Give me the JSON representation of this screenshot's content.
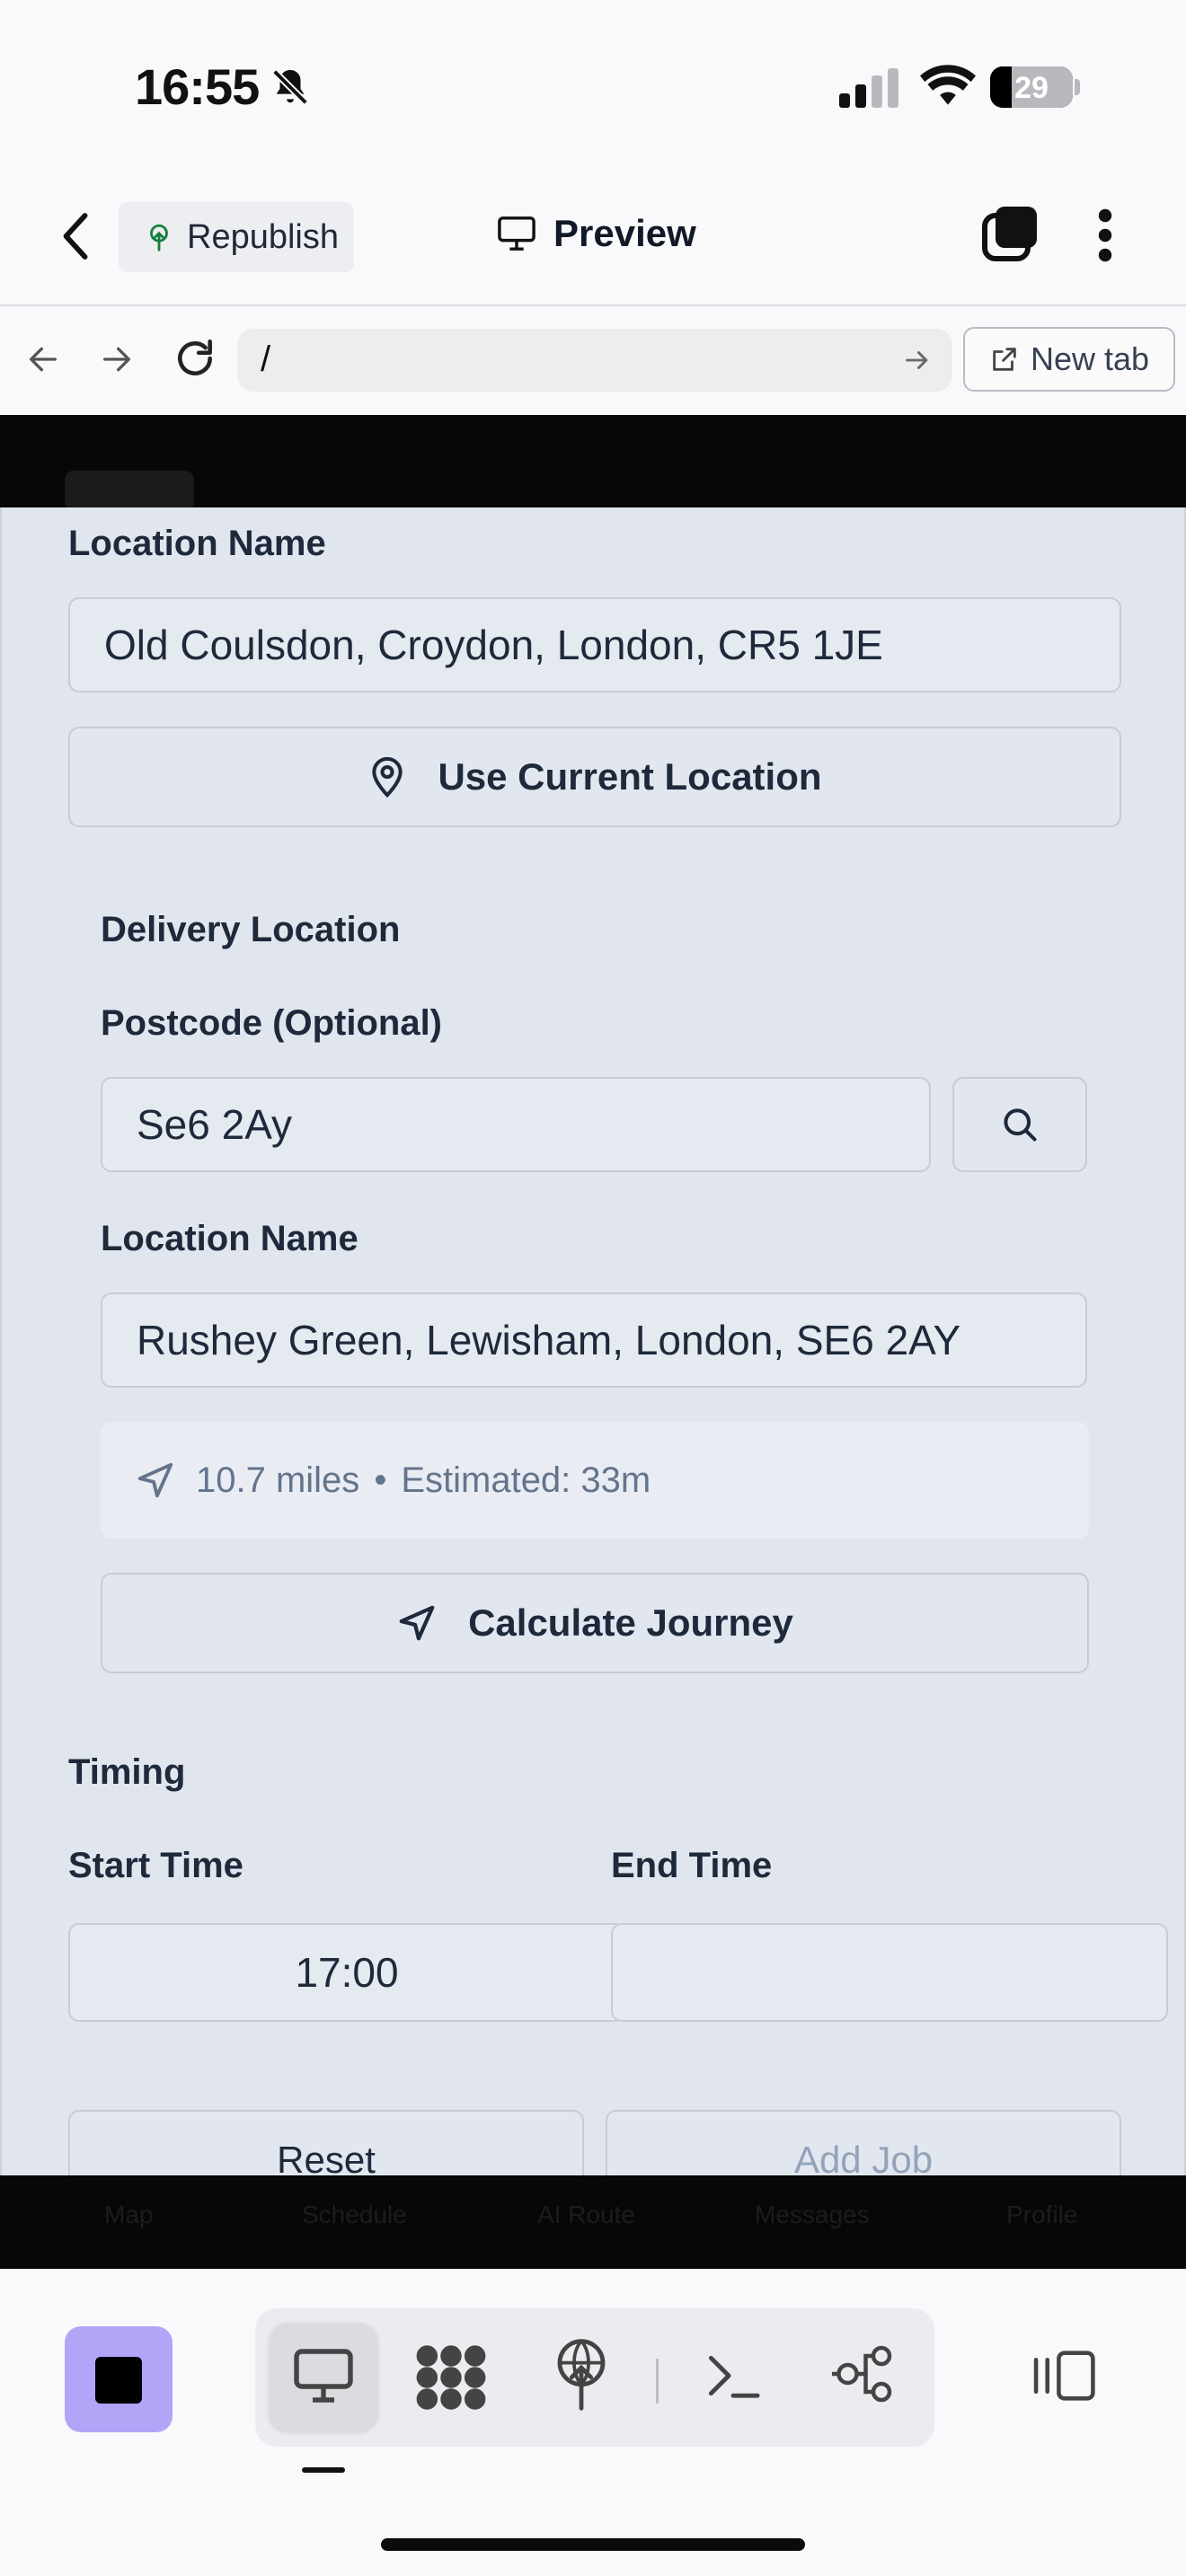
{
  "status_bar": {
    "time": "16:55",
    "battery": "29"
  },
  "header": {
    "republish_label": "Republish",
    "preview_label": "Preview"
  },
  "browser": {
    "url": "/",
    "new_tab_label": "New tab"
  },
  "form": {
    "pickup": {
      "location_name_label": "Location Name",
      "location_name_value": "Old Coulsdon, Croydon, London, CR5 1JE",
      "use_current_location_label": "Use Current Location"
    },
    "delivery": {
      "section_title": "Delivery Location",
      "postcode_label": "Postcode (Optional)",
      "postcode_value": "Se6 2Ay",
      "location_name_label": "Location Name",
      "location_name_value": "Rushey Green, Lewisham, London, SE6 2AY",
      "journey_distance": "10.7 miles",
      "journey_separator": "•",
      "journey_estimate": "Estimated: 33m",
      "calculate_label": "Calculate Journey"
    },
    "timing": {
      "section_title": "Timing",
      "start_label": "Start Time",
      "start_value": "17:00",
      "end_label": "End Time",
      "end_value": ""
    },
    "actions": {
      "reset_label": "Reset",
      "add_job_label": "Add Job"
    }
  },
  "bottom_nav": [
    "Map",
    "Schedule",
    "AI Route",
    "Messages",
    "Profile"
  ]
}
